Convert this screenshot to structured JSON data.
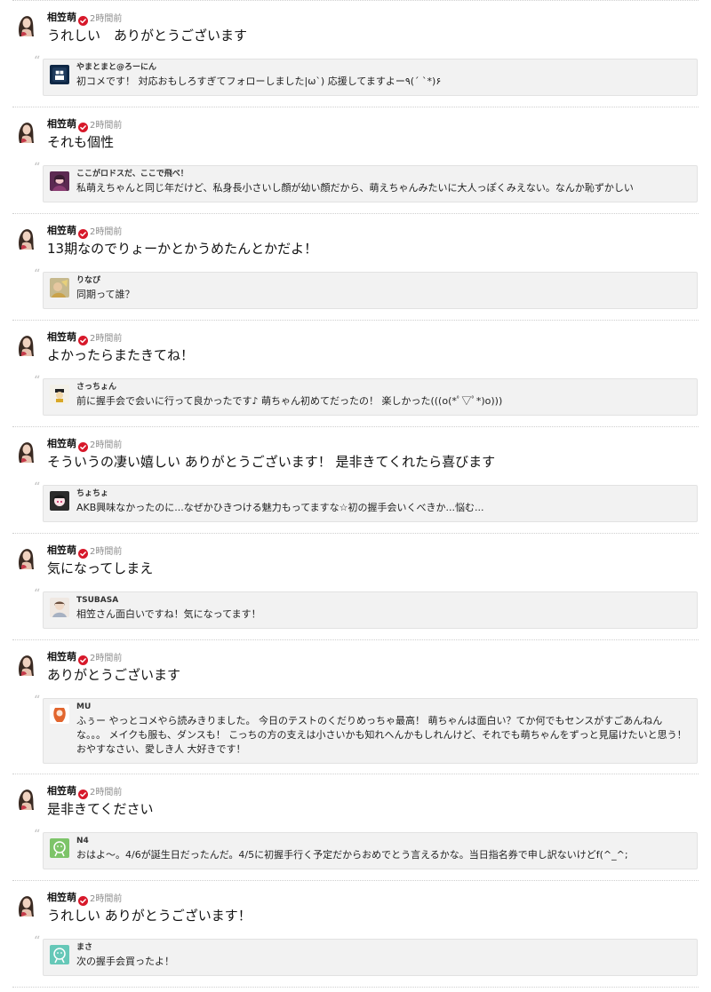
{
  "author": {
    "name": "相笠萌",
    "time": "2時間前",
    "accent_color": "#d7182a"
  },
  "entries": [
    {
      "reply": "うれしい　ありがとうございます",
      "commenter": {
        "name": "やまとまと@ろーにん",
        "avatar": "avatar-icon-tag"
      },
      "comment": "初コメです！ 対応おもしろすぎてフォローしました|ω`) 応援してますよー٩(´ `*)۶"
    },
    {
      "reply": "それも個性",
      "commenter": {
        "name": "ここがロドスだ、ここで飛べ！",
        "avatar": "avatar-photo-pink"
      },
      "comment": "私萌えちゃんと同じ年だけど、私身長小さいし顔が幼い顔だから、萌えちゃんみたいに大人っぽくみえない。なんか恥ずかしい"
    },
    {
      "reply": "13期なのでりょーかとかうめたんとかだよ！",
      "commenter": {
        "name": "りなぴ",
        "avatar": "avatar-photo-yellow"
      },
      "comment": "同期って誰？"
    },
    {
      "reply": "よかったらまたきてね！",
      "commenter": {
        "name": "さっちょん",
        "avatar": "avatar-character"
      },
      "comment": "前に握手会で会いに行って良かったです♪ 萌ちゃん初めてだったの！ 楽しかった(((o(*ﾟ▽ﾟ*)o)))"
    },
    {
      "reply": "そういうの凄い嬉しい ありがとうございます！ 是非きてくれたら喜びます",
      "commenter": {
        "name": "ちょちょ",
        "avatar": "avatar-anime"
      },
      "comment": "AKB興味なかったのに...なぜかひきつける魅力もってますな☆初の握手会いくべきか...悩む..."
    },
    {
      "reply": "気になってしまえ",
      "commenter": {
        "name": "TSUBASA",
        "avatar": "avatar-photo-light"
      },
      "comment": "相笠さん面白いですね！気になってます！"
    },
    {
      "reply": "ありがとうございます",
      "commenter": {
        "name": "MU",
        "avatar": "avatar-illustration"
      },
      "comment": "ふぅー やっとコメやら読みきりました。 今日のテストのくだりめっちゃ最高！ 萌ちゃんは面白い？てか何でもセンスがすごあんねんな。。。 メイクも服も、ダンスも！ こっちの方の支えは小さいかも知れへんかもしれんけど、それでも萌ちゃんをずっと見届けたいと思う！ おやすなさい、愛しき人 大好きです！"
    },
    {
      "reply": "是非きてください",
      "commenter": {
        "name": "N4",
        "avatar": "avatar-default-green"
      },
      "comment": "おはよ～。4/6が誕生日だったんだ。4/5に初握手行く予定だからおめでとう言えるかな。当日指名券で申し訳ないけどf(^_^;"
    },
    {
      "reply": "うれしい ありがとうございます！",
      "commenter": {
        "name": "まさ",
        "avatar": "avatar-default-teal"
      },
      "comment": "次の握手会買ったよ！"
    }
  ]
}
